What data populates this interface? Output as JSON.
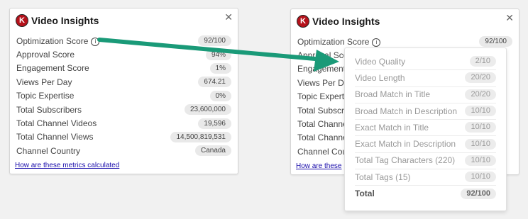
{
  "left_panel": {
    "logo_letter": "K",
    "title": "Video Insights",
    "close": "✕",
    "rows": [
      {
        "label": "Optimization Score",
        "value": "92/100",
        "info": "i"
      },
      {
        "label": "Approval Score",
        "value": "94%"
      },
      {
        "label": "Engagement Score",
        "value": "1%"
      },
      {
        "label": "Views Per Day",
        "value": "674.21"
      },
      {
        "label": "Topic Expertise",
        "value": "0%"
      },
      {
        "label": "Total Subscribers",
        "value": "23,600,000"
      },
      {
        "label": "Total Channel Videos",
        "value": "19,596"
      },
      {
        "label": "Total Channel Views",
        "value": "14,500,819,531"
      },
      {
        "label": "Channel Country",
        "value": "Canada"
      }
    ],
    "footer_link": "How are these metrics calculated"
  },
  "right_panel": {
    "logo_letter": "K",
    "title": "Video Insights",
    "close": "✕",
    "rows": [
      {
        "label": "Optimization Score",
        "value": "92/100",
        "info": "i"
      },
      {
        "label": "Approval Score",
        "value": ""
      },
      {
        "label": "Engagement S",
        "value": ""
      },
      {
        "label": "Views Per Day",
        "value": ""
      },
      {
        "label": "Topic Expertis",
        "value": ""
      },
      {
        "label": "Total Subscrib",
        "value": ""
      },
      {
        "label": "Total Channel",
        "value": ""
      },
      {
        "label": "Total Channel",
        "value": ""
      },
      {
        "label": "Channel Coun",
        "value": ""
      }
    ],
    "footer_link": "How are these"
  },
  "breakdown": {
    "rows": [
      {
        "label": "Video Quality",
        "value": "2/10"
      },
      {
        "label": "Video Length",
        "value": "20/20"
      },
      {
        "label": "Broad Match in Title",
        "value": "20/20"
      },
      {
        "label": "Broad Match in Description",
        "value": "10/10"
      },
      {
        "label": "Exact Match in Title",
        "value": "10/10"
      },
      {
        "label": "Exact Match in Description",
        "value": "10/10"
      },
      {
        "label": "Total Tag Characters (220)",
        "value": "10/10"
      },
      {
        "label": "Total Tags (15)",
        "value": "10/10"
      }
    ],
    "total": {
      "label": "Total",
      "value": "92/100"
    }
  },
  "colors": {
    "arrow": "#1a9a78",
    "logo": "#b5121b",
    "link": "#1a0dab"
  }
}
